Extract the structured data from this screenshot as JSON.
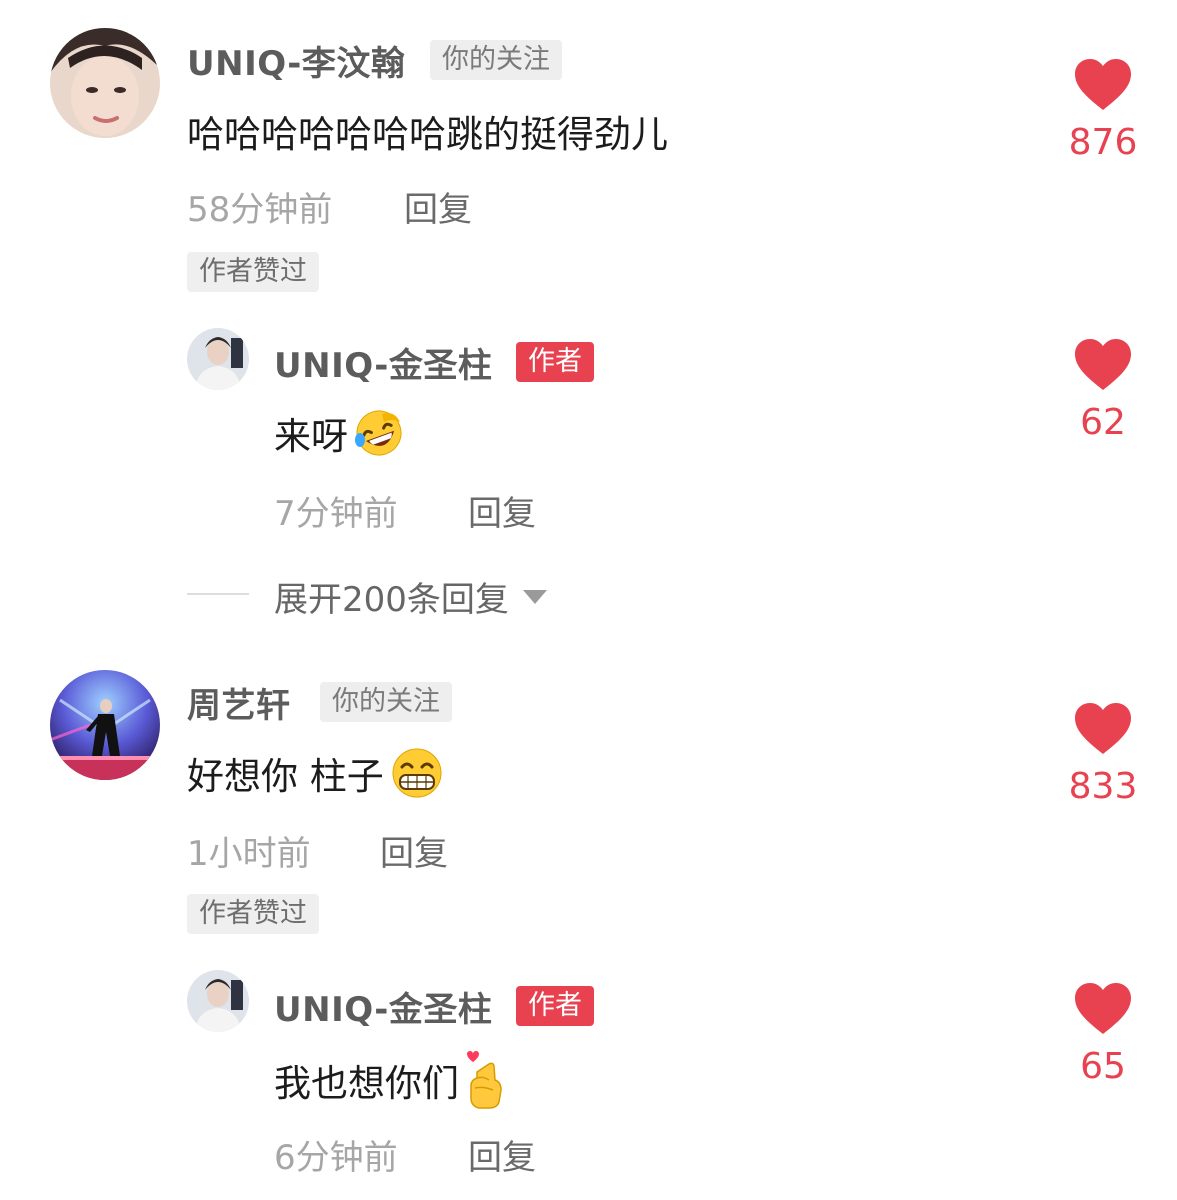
{
  "colors": {
    "accent": "#e8414f",
    "muted_text": "#a6a6a6",
    "username_text": "#5c5c5c"
  },
  "comments": [
    {
      "username": "UNIQ-李汶翰",
      "follow_tag": "你的关注",
      "text": "哈哈哈哈哈哈哈跳的挺得劲儿",
      "time": "58分钟前",
      "reply_label": "回复",
      "liked_tag": "作者赞过",
      "likes": "876",
      "replies": [
        {
          "username": "UNIQ-金圣柱",
          "author_tag": "作者",
          "text": "来呀",
          "emoji": "rofl-emoji",
          "time": "7分钟前",
          "reply_label": "回复",
          "likes": "62"
        }
      ],
      "expand_label": "展开200条回复"
    },
    {
      "username": "周艺轩",
      "follow_tag": "你的关注",
      "text": "好想你 柱子",
      "emoji": "grin-emoji",
      "time": "1小时前",
      "reply_label": "回复",
      "liked_tag": "作者赞过",
      "likes": "833",
      "replies": [
        {
          "username": "UNIQ-金圣柱",
          "author_tag": "作者",
          "text": "我也想你们",
          "emoji": "finger-heart-emoji",
          "time": "6分钟前",
          "reply_label": "回复",
          "likes": "65"
        }
      ]
    }
  ]
}
